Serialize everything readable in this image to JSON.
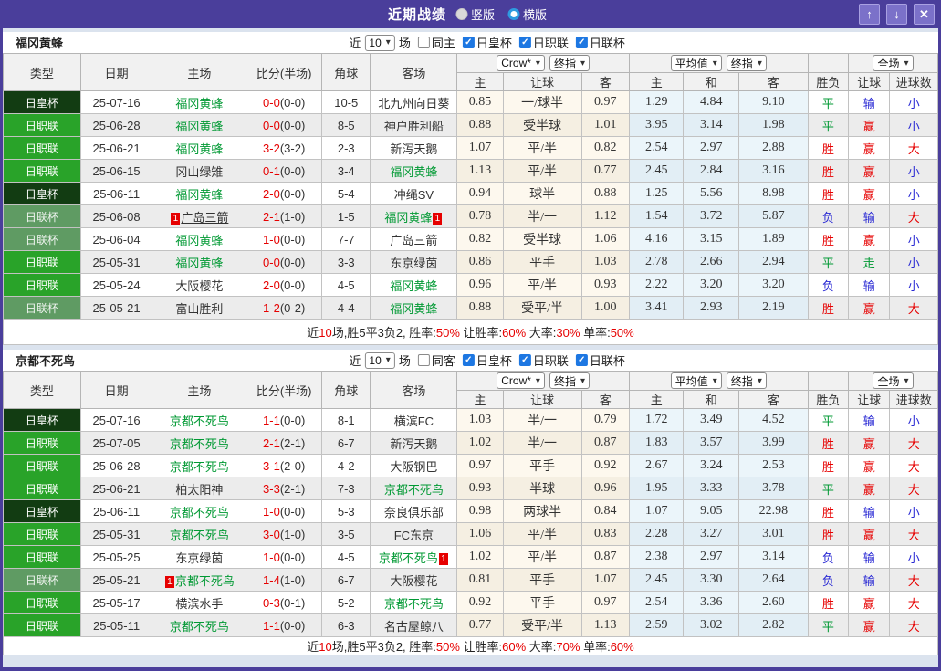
{
  "icons": {
    "chevron_down": "▾",
    "up_arrow": "↑",
    "down_arrow": "↓",
    "close": "✕",
    "check": "✓"
  },
  "header": {
    "title": "近期战绩",
    "radios": [
      {
        "label": "竖版",
        "selected": false
      },
      {
        "label": "横版",
        "selected": true
      }
    ]
  },
  "columns": {
    "type": "类型",
    "date": "日期",
    "home": "主场",
    "score": "比分(半场)",
    "corner": "角球",
    "away": "客场",
    "odds_source": "Crow*",
    "odds_final": "终指",
    "odds_home": "主",
    "odds_handicap": "让球",
    "odds_away": "客",
    "avg_source": "平均值",
    "avg_final": "终指",
    "avg_home": "主",
    "avg_draw": "和",
    "avg_away": "客",
    "result": "胜负",
    "handicap": "让球",
    "goals": "进球数",
    "scope": "全场"
  },
  "sections": [
    {
      "team": "福冈黄蜂",
      "controls": {
        "near": "近",
        "count": "10",
        "field": "场",
        "same": "同主",
        "same_checked": false,
        "cups": [
          "日皇杯",
          "日职联",
          "日联杯"
        ],
        "cups_checked": [
          true,
          true,
          true
        ]
      },
      "rows": [
        {
          "type": "日皇杯",
          "type_style": "royal",
          "date": "25-07-16",
          "home": {
            "name": "福冈黄蜂",
            "green": true
          },
          "score": "0-0",
          "half": "(0-0)",
          "corner": "10-5",
          "away": {
            "name": "北九州向日葵"
          },
          "odds": [
            "0.85",
            "一/球半",
            "0.97"
          ],
          "avg": [
            "1.29",
            "4.84",
            "9.10"
          ],
          "res": [
            "平",
            "green"
          ],
          "han": [
            "输",
            "blue"
          ],
          "goal": [
            "小",
            "blue"
          ]
        },
        {
          "type": "日职联",
          "type_style": "league",
          "date": "25-06-28",
          "home": {
            "name": "福冈黄蜂",
            "green": true
          },
          "score": "0-0",
          "half": "(0-0)",
          "corner": "8-5",
          "away": {
            "name": "神户胜利船"
          },
          "odds": [
            "0.88",
            "受半球",
            "1.01"
          ],
          "avg": [
            "3.95",
            "3.14",
            "1.98"
          ],
          "res": [
            "平",
            "green"
          ],
          "han": [
            "赢",
            "red"
          ],
          "goal": [
            "小",
            "blue"
          ]
        },
        {
          "type": "日职联",
          "type_style": "league",
          "date": "25-06-21",
          "home": {
            "name": "福冈黄蜂",
            "green": true
          },
          "score": "3-2",
          "half": "(3-2)",
          "corner": "2-3",
          "away": {
            "name": "新泻天鹅"
          },
          "odds": [
            "1.07",
            "平/半",
            "0.82"
          ],
          "avg": [
            "2.54",
            "2.97",
            "2.88"
          ],
          "res": [
            "胜",
            "red"
          ],
          "han": [
            "赢",
            "red"
          ],
          "goal": [
            "大",
            "red"
          ]
        },
        {
          "type": "日职联",
          "type_style": "league",
          "date": "25-06-15",
          "home": {
            "name": "冈山绿雉"
          },
          "score": "0-1",
          "half": "(0-0)",
          "corner": "3-4",
          "away": {
            "name": "福冈黄蜂",
            "green": true
          },
          "odds": [
            "1.13",
            "平/半",
            "0.77"
          ],
          "avg": [
            "2.45",
            "2.84",
            "3.16"
          ],
          "res": [
            "胜",
            "red"
          ],
          "han": [
            "赢",
            "red"
          ],
          "goal": [
            "小",
            "blue"
          ]
        },
        {
          "type": "日皇杯",
          "type_style": "royal",
          "date": "25-06-11",
          "home": {
            "name": "福冈黄蜂",
            "green": true
          },
          "score": "2-0",
          "half": "(0-0)",
          "corner": "5-4",
          "away": {
            "name": "冲绳SV"
          },
          "odds": [
            "0.94",
            "球半",
            "0.88"
          ],
          "avg": [
            "1.25",
            "5.56",
            "8.98"
          ],
          "res": [
            "胜",
            "red"
          ],
          "han": [
            "赢",
            "red"
          ],
          "goal": [
            "小",
            "blue"
          ]
        },
        {
          "type": "日联杯",
          "type_style": "cup",
          "date": "25-06-08",
          "home": {
            "name": "广岛三箭",
            "badge_before": "1",
            "underline": true
          },
          "score": "2-1",
          "half": "(1-0)",
          "corner": "1-5",
          "away": {
            "name": "福冈黄蜂",
            "green": true,
            "badge_after": "1"
          },
          "odds": [
            "0.78",
            "半/一",
            "1.12"
          ],
          "avg": [
            "1.54",
            "3.72",
            "5.87"
          ],
          "res": [
            "负",
            "blue"
          ],
          "han": [
            "输",
            "blue"
          ],
          "goal": [
            "大",
            "red"
          ]
        },
        {
          "type": "日联杯",
          "type_style": "cup",
          "date": "25-06-04",
          "home": {
            "name": "福冈黄蜂",
            "green": true
          },
          "score": "1-0",
          "half": "(0-0)",
          "corner": "7-7",
          "away": {
            "name": "广岛三箭"
          },
          "odds": [
            "0.82",
            "受半球",
            "1.06"
          ],
          "avg": [
            "4.16",
            "3.15",
            "1.89"
          ],
          "res": [
            "胜",
            "red"
          ],
          "han": [
            "赢",
            "red"
          ],
          "goal": [
            "小",
            "blue"
          ]
        },
        {
          "type": "日职联",
          "type_style": "league",
          "date": "25-05-31",
          "home": {
            "name": "福冈黄蜂",
            "green": true
          },
          "score": "0-0",
          "half": "(0-0)",
          "corner": "3-3",
          "away": {
            "name": "东京绿茵"
          },
          "odds": [
            "0.86",
            "平手",
            "1.03"
          ],
          "avg": [
            "2.78",
            "2.66",
            "2.94"
          ],
          "res": [
            "平",
            "green"
          ],
          "han": [
            "走",
            "green"
          ],
          "goal": [
            "小",
            "blue"
          ]
        },
        {
          "type": "日职联",
          "type_style": "league",
          "date": "25-05-24",
          "home": {
            "name": "大阪樱花"
          },
          "score": "2-0",
          "half": "(0-0)",
          "corner": "4-5",
          "away": {
            "name": "福冈黄蜂",
            "green": true
          },
          "odds": [
            "0.96",
            "平/半",
            "0.93"
          ],
          "avg": [
            "2.22",
            "3.20",
            "3.20"
          ],
          "res": [
            "负",
            "blue"
          ],
          "han": [
            "输",
            "blue"
          ],
          "goal": [
            "小",
            "blue"
          ]
        },
        {
          "type": "日联杯",
          "type_style": "cup",
          "date": "25-05-21",
          "home": {
            "name": "富山胜利"
          },
          "score": "1-2",
          "half": "(0-2)",
          "corner": "4-4",
          "away": {
            "name": "福冈黄蜂",
            "green": true
          },
          "odds": [
            "0.88",
            "受平/半",
            "1.00"
          ],
          "avg": [
            "3.41",
            "2.93",
            "2.19"
          ],
          "res": [
            "胜",
            "red"
          ],
          "han": [
            "赢",
            "red"
          ],
          "goal": [
            "大",
            "red"
          ]
        }
      ],
      "summary": [
        {
          "t": "近"
        },
        {
          "t": "10",
          "red": true
        },
        {
          "t": "场,胜5平3负2, 胜率:"
        },
        {
          "t": "50%",
          "red": true
        },
        {
          "t": " 让胜率:"
        },
        {
          "t": "60%",
          "red": true
        },
        {
          "t": " 大率:"
        },
        {
          "t": "30%",
          "red": true
        },
        {
          "t": " 单率:"
        },
        {
          "t": "50%",
          "red": true
        }
      ]
    },
    {
      "team": "京都不死鸟",
      "controls": {
        "near": "近",
        "count": "10",
        "field": "场",
        "same": "同客",
        "same_checked": false,
        "cups": [
          "日皇杯",
          "日职联",
          "日联杯"
        ],
        "cups_checked": [
          true,
          true,
          true
        ]
      },
      "rows": [
        {
          "type": "日皇杯",
          "type_style": "royal",
          "date": "25-07-16",
          "home": {
            "name": "京都不死鸟",
            "green": true
          },
          "score": "1-1",
          "half": "(0-0)",
          "corner": "8-1",
          "away": {
            "name": "横滨FC"
          },
          "odds": [
            "1.03",
            "半/一",
            "0.79"
          ],
          "avg": [
            "1.72",
            "3.49",
            "4.52"
          ],
          "res": [
            "平",
            "green"
          ],
          "han": [
            "输",
            "blue"
          ],
          "goal": [
            "小",
            "blue"
          ]
        },
        {
          "type": "日职联",
          "type_style": "league",
          "date": "25-07-05",
          "home": {
            "name": "京都不死鸟",
            "green": true
          },
          "score": "2-1",
          "half": "(2-1)",
          "corner": "6-7",
          "away": {
            "name": "新泻天鹅"
          },
          "odds": [
            "1.02",
            "半/一",
            "0.87"
          ],
          "avg": [
            "1.83",
            "3.57",
            "3.99"
          ],
          "res": [
            "胜",
            "red"
          ],
          "han": [
            "赢",
            "red"
          ],
          "goal": [
            "大",
            "red"
          ]
        },
        {
          "type": "日职联",
          "type_style": "league",
          "date": "25-06-28",
          "home": {
            "name": "京都不死鸟",
            "green": true
          },
          "score": "3-1",
          "half": "(2-0)",
          "corner": "4-2",
          "away": {
            "name": "大阪钢巴"
          },
          "odds": [
            "0.97",
            "平手",
            "0.92"
          ],
          "avg": [
            "2.67",
            "3.24",
            "2.53"
          ],
          "res": [
            "胜",
            "red"
          ],
          "han": [
            "赢",
            "red"
          ],
          "goal": [
            "大",
            "red"
          ]
        },
        {
          "type": "日职联",
          "type_style": "league",
          "date": "25-06-21",
          "home": {
            "name": "柏太阳神"
          },
          "score": "3-3",
          "half": "(2-1)",
          "corner": "7-3",
          "away": {
            "name": "京都不死鸟",
            "green": true
          },
          "odds": [
            "0.93",
            "半球",
            "0.96"
          ],
          "avg": [
            "1.95",
            "3.33",
            "3.78"
          ],
          "res": [
            "平",
            "green"
          ],
          "han": [
            "赢",
            "red"
          ],
          "goal": [
            "大",
            "red"
          ]
        },
        {
          "type": "日皇杯",
          "type_style": "royal",
          "date": "25-06-11",
          "home": {
            "name": "京都不死鸟",
            "green": true
          },
          "score": "1-0",
          "half": "(0-0)",
          "corner": "5-3",
          "away": {
            "name": "奈良俱乐部"
          },
          "odds": [
            "0.98",
            "两球半",
            "0.84"
          ],
          "avg": [
            "1.07",
            "9.05",
            "22.98"
          ],
          "res": [
            "胜",
            "red"
          ],
          "han": [
            "输",
            "blue"
          ],
          "goal": [
            "小",
            "blue"
          ]
        },
        {
          "type": "日职联",
          "type_style": "league",
          "date": "25-05-31",
          "home": {
            "name": "京都不死鸟",
            "green": true
          },
          "score": "3-0",
          "half": "(1-0)",
          "corner": "3-5",
          "away": {
            "name": "FC东京"
          },
          "odds": [
            "1.06",
            "平/半",
            "0.83"
          ],
          "avg": [
            "2.28",
            "3.27",
            "3.01"
          ],
          "res": [
            "胜",
            "red"
          ],
          "han": [
            "赢",
            "red"
          ],
          "goal": [
            "大",
            "red"
          ]
        },
        {
          "type": "日职联",
          "type_style": "league",
          "date": "25-05-25",
          "home": {
            "name": "东京绿茵"
          },
          "score": "1-0",
          "half": "(0-0)",
          "corner": "4-5",
          "away": {
            "name": "京都不死鸟",
            "green": true,
            "badge_after": "1"
          },
          "odds": [
            "1.02",
            "平/半",
            "0.87"
          ],
          "avg": [
            "2.38",
            "2.97",
            "3.14"
          ],
          "res": [
            "负",
            "blue"
          ],
          "han": [
            "输",
            "blue"
          ],
          "goal": [
            "小",
            "blue"
          ]
        },
        {
          "type": "日联杯",
          "type_style": "cup",
          "date": "25-05-21",
          "home": {
            "name": "京都不死鸟",
            "green": true,
            "badge_before": "1"
          },
          "score": "1-4",
          "half": "(1-0)",
          "corner": "6-7",
          "away": {
            "name": "大阪樱花"
          },
          "odds": [
            "0.81",
            "平手",
            "1.07"
          ],
          "avg": [
            "2.45",
            "3.30",
            "2.64"
          ],
          "res": [
            "负",
            "blue"
          ],
          "han": [
            "输",
            "blue"
          ],
          "goal": [
            "大",
            "red"
          ]
        },
        {
          "type": "日职联",
          "type_style": "league",
          "date": "25-05-17",
          "home": {
            "name": "横滨水手"
          },
          "score": "0-3",
          "half": "(0-1)",
          "corner": "5-2",
          "away": {
            "name": "京都不死鸟",
            "green": true
          },
          "odds": [
            "0.92",
            "平手",
            "0.97"
          ],
          "avg": [
            "2.54",
            "3.36",
            "2.60"
          ],
          "res": [
            "胜",
            "red"
          ],
          "han": [
            "赢",
            "red"
          ],
          "goal": [
            "大",
            "red"
          ]
        },
        {
          "type": "日职联",
          "type_style": "league",
          "date": "25-05-11",
          "home": {
            "name": "京都不死鸟",
            "green": true
          },
          "score": "1-1",
          "half": "(0-0)",
          "corner": "6-3",
          "away": {
            "name": "名古屋鲸八"
          },
          "odds": [
            "0.77",
            "受平/半",
            "1.13"
          ],
          "avg": [
            "2.59",
            "3.02",
            "2.82"
          ],
          "res": [
            "平",
            "green"
          ],
          "han": [
            "赢",
            "red"
          ],
          "goal": [
            "大",
            "red"
          ]
        }
      ],
      "summary": [
        {
          "t": "近"
        },
        {
          "t": "10",
          "red": true
        },
        {
          "t": "场,胜5平3负2, 胜率:"
        },
        {
          "t": "50%",
          "red": true
        },
        {
          "t": " 让胜率:"
        },
        {
          "t": "60%",
          "red": true
        },
        {
          "t": " 大率:"
        },
        {
          "t": "70%",
          "red": true
        },
        {
          "t": " 单率:"
        },
        {
          "t": "60%",
          "red": true
        }
      ]
    }
  ]
}
